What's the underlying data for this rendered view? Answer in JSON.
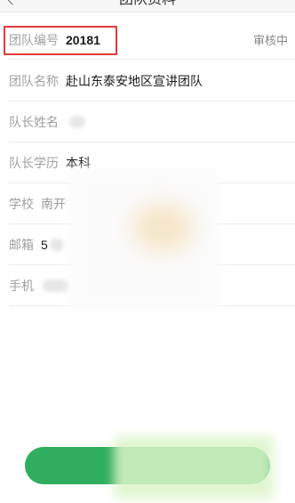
{
  "header": {
    "title": "团队资料"
  },
  "profile": {
    "team_id": {
      "label": "团队编号",
      "value": "20181",
      "status": "审核中"
    },
    "team_name": {
      "label": "团队名称",
      "value": "赴山东泰安地区宣讲团队"
    },
    "leader_name": {
      "label": "队长姓名",
      "value": ""
    },
    "education": {
      "label": "队长学历",
      "value": "本科"
    },
    "school": {
      "label": "学校",
      "value": "南开"
    },
    "email": {
      "label": "邮箱",
      "value": "5"
    },
    "phone": {
      "label": "手机",
      "value": ""
    }
  },
  "colors": {
    "accent": "#2fae5f",
    "highlight": "#e03b3b"
  }
}
